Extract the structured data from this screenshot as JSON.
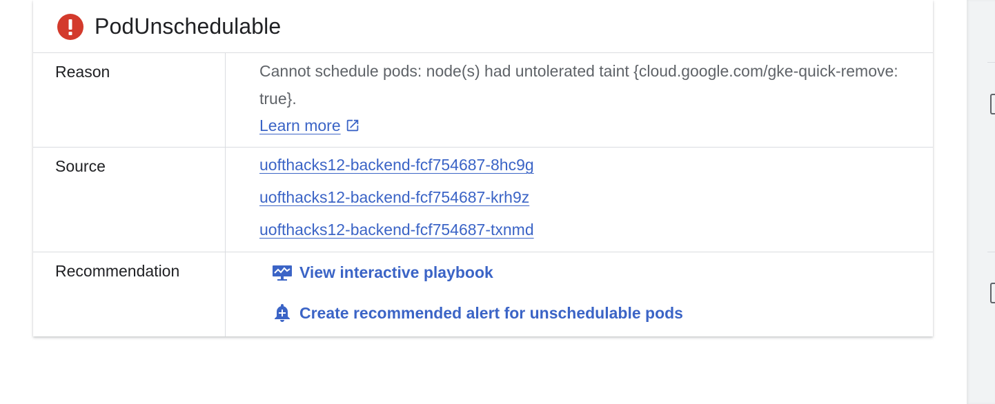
{
  "card": {
    "title": "PodUnschedulable",
    "icon": "error-icon"
  },
  "rows": {
    "reason": {
      "label": "Reason",
      "text": "Cannot schedule pods: node(s) had untolerated taint {cloud.google.com/gke-quick-remove: true}.",
      "learn_more": "Learn more"
    },
    "source": {
      "label": "Source",
      "links": [
        "uofthacks12-backend-fcf754687-8hc9g",
        "uofthacks12-backend-fcf754687-krh9z",
        "uofthacks12-backend-fcf754687-txnmd"
      ]
    },
    "recommendation": {
      "label": "Recommendation",
      "actions": [
        {
          "label": "View interactive playbook",
          "icon": "playbook-icon"
        },
        {
          "label": "Create recommended alert for unschedulable pods",
          "icon": "add-alert-icon"
        }
      ]
    }
  },
  "colors": {
    "error": "#d33a2c",
    "link": "#3b64c6",
    "text": "#202124",
    "secondary_text": "#5f6368",
    "divider": "#dadce0"
  }
}
